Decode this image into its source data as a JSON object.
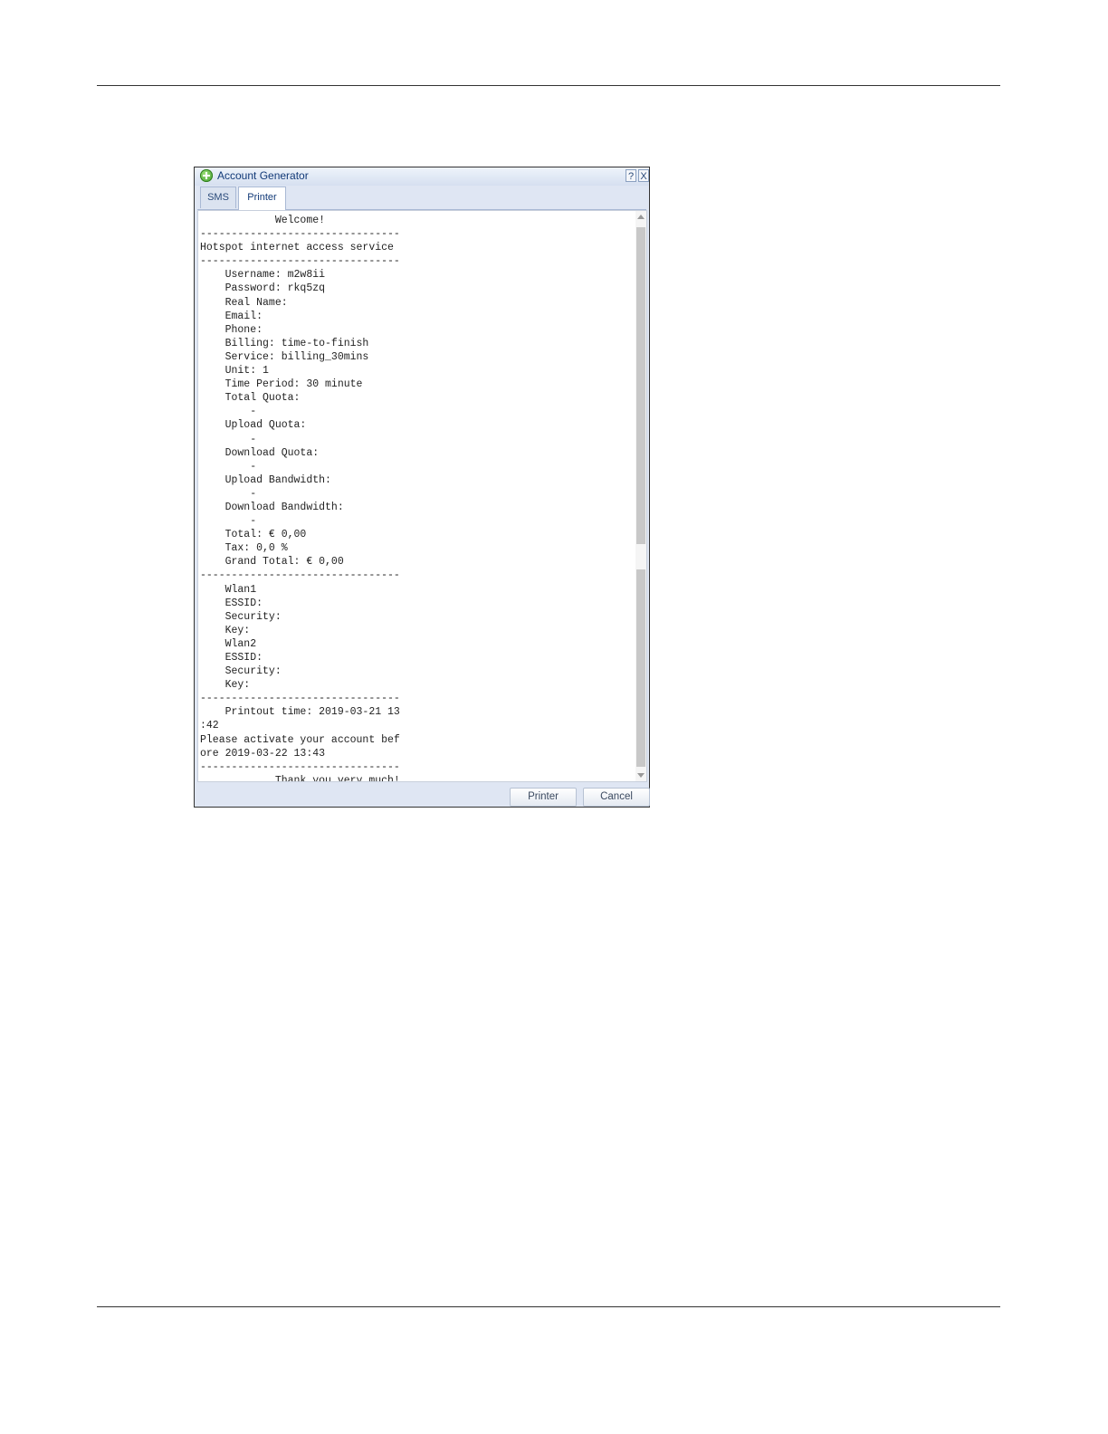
{
  "dialog": {
    "title": "Account Generator",
    "help_label": "?",
    "close_label": "X"
  },
  "tabs": [
    {
      "label": "SMS"
    },
    {
      "label": "Printer"
    }
  ],
  "receipt": {
    "text": "            Welcome!\n--------------------------------\nHotspot internet access service\n--------------------------------\n    Username: m2w8ii\n    Password: rkq5zq\n    Real Name:\n    Email:\n    Phone:\n    Billing: time-to-finish\n    Service: billing_30mins\n    Unit: 1\n    Time Period: 30 minute\n    Total Quota:\n        -\n    Upload Quota:\n        -\n    Download Quota:\n        -\n    Upload Bandwidth:\n        -\n    Download Bandwidth:\n        -\n    Total: € 0,00\n    Tax: 0,0 %\n    Grand Total: € 0,00\n--------------------------------\n    Wlan1\n    ESSID:\n    Security:\n    Key:\n    Wlan2\n    ESSID:\n    Security:\n    Key:\n--------------------------------\n    Printout time: 2019-03-21 13\n:42\nPlease activate your account bef\nore 2019-03-22 13:43\n--------------------------------\n            Thank you very much!"
  },
  "buttons": {
    "printer_label": "Printer",
    "cancel_label": "Cancel"
  }
}
